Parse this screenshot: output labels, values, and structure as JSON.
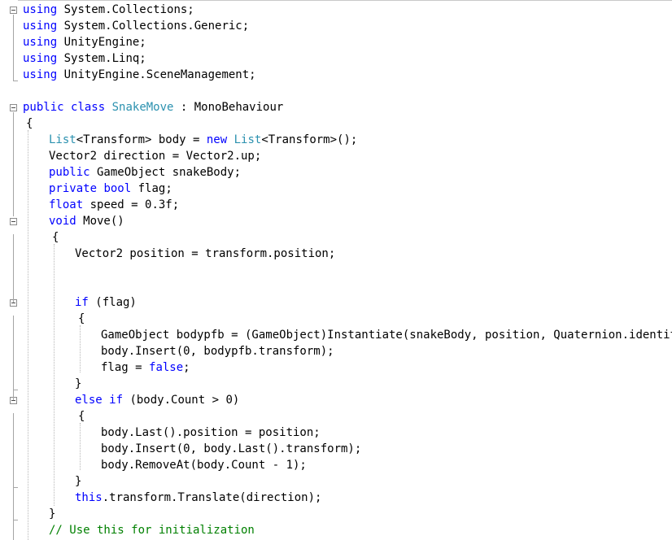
{
  "editor": {
    "lines": [
      [
        [
          "kw",
          "using"
        ],
        [
          "t",
          " System.Collections;"
        ]
      ],
      [
        [
          "kw",
          "using"
        ],
        [
          "t",
          " System.Collections.Generic;"
        ]
      ],
      [
        [
          "kw",
          "using"
        ],
        [
          "t",
          " UnityEngine;"
        ]
      ],
      [
        [
          "kw",
          "using"
        ],
        [
          "t",
          " System.Linq;"
        ]
      ],
      [
        [
          "kw",
          "using"
        ],
        [
          "t",
          " UnityEngine.SceneManagement;"
        ]
      ],
      [],
      [
        [
          "kw",
          "public"
        ],
        [
          "t",
          " "
        ],
        [
          "kw",
          "class"
        ],
        [
          "t",
          " "
        ],
        [
          "ty",
          "SnakeMove"
        ],
        [
          "t",
          " : MonoBehaviour"
        ]
      ],
      [
        [
          "t",
          "{"
        ]
      ],
      [
        [
          "ty",
          "List"
        ],
        [
          "t",
          "<Transform> body = "
        ],
        [
          "kw",
          "new"
        ],
        [
          "t",
          " "
        ],
        [
          "ty",
          "List"
        ],
        [
          "t",
          "<Transform>();"
        ]
      ],
      [
        [
          "t",
          "Vector2 direction = Vector2.up;"
        ]
      ],
      [
        [
          "kw",
          "public"
        ],
        [
          "t",
          " GameObject snakeBody;"
        ]
      ],
      [
        [
          "kw",
          "private"
        ],
        [
          "t",
          " "
        ],
        [
          "kw",
          "bool"
        ],
        [
          "t",
          " flag;"
        ]
      ],
      [
        [
          "kw",
          "float"
        ],
        [
          "t",
          " speed = 0.3f;"
        ]
      ],
      [
        [
          "kw",
          "void"
        ],
        [
          "t",
          " Move()"
        ]
      ],
      [
        [
          "t",
          "{"
        ]
      ],
      [
        [
          "t",
          "Vector2 position = transform.position;"
        ]
      ],
      [],
      [],
      [
        [
          "kw",
          "if"
        ],
        [
          "t",
          " (flag)"
        ]
      ],
      [
        [
          "t",
          "{"
        ]
      ],
      [
        [
          "t",
          "GameObject bodypfb = (GameObject)Instantiate(snakeBody, position, Quaternion.identity);"
        ]
      ],
      [
        [
          "t",
          "body.Insert(0, bodypfb.transform);"
        ]
      ],
      [
        [
          "t",
          "flag = "
        ],
        [
          "kw",
          "false"
        ],
        [
          "t",
          ";"
        ]
      ],
      [
        [
          "t",
          "}"
        ]
      ],
      [
        [
          "kw",
          "else"
        ],
        [
          "t",
          " "
        ],
        [
          "kw",
          "if"
        ],
        [
          "t",
          " (body.Count > 0)"
        ]
      ],
      [
        [
          "t",
          "{"
        ]
      ],
      [
        [
          "t",
          "body.Last().position = position;"
        ]
      ],
      [
        [
          "t",
          "body.Insert(0, body.Last().transform);"
        ]
      ],
      [
        [
          "t",
          "body.RemoveAt(body.Count - 1);"
        ]
      ],
      [
        [
          "t",
          "}"
        ]
      ],
      [
        [
          "kw",
          "this"
        ],
        [
          "t",
          ".transform.Translate(direction);"
        ]
      ],
      [
        [
          "t",
          "}"
        ]
      ],
      [
        [
          "cm",
          "// Use this for initialization"
        ]
      ]
    ],
    "fold_icons": [
      "collapse-icon",
      "collapse-icon",
      "collapse-icon",
      "collapse-icon",
      "collapse-icon"
    ]
  }
}
